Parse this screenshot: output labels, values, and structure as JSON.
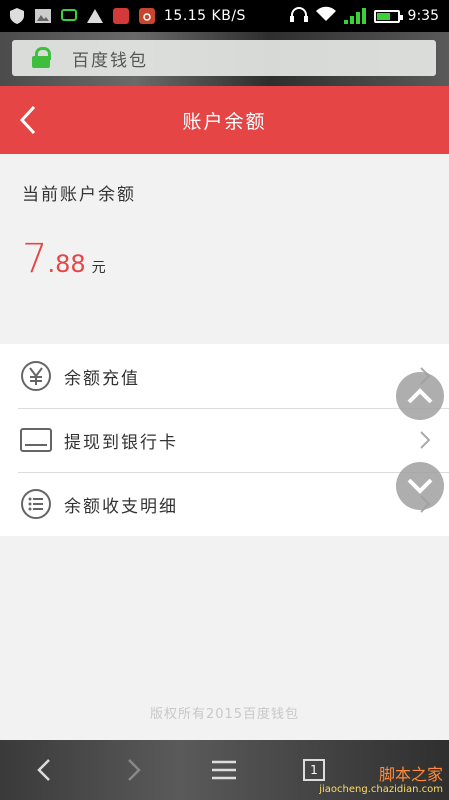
{
  "status_bar": {
    "speed": "15.15 KB/S",
    "time": "9:35"
  },
  "address_bar": {
    "text": "百度钱包"
  },
  "header": {
    "title": "账户余额"
  },
  "balance": {
    "label": "当前账户余额",
    "integer": "7",
    "decimal": ".88",
    "unit": "元"
  },
  "menu": {
    "items": [
      {
        "label": "余额充值",
        "icon": "yuan-icon"
      },
      {
        "label": "提现到银行卡",
        "icon": "card-icon"
      },
      {
        "label": "余额收支明细",
        "icon": "list-icon"
      }
    ]
  },
  "footer": {
    "copyright": "版权所有2015百度钱包"
  },
  "bottom_bar": {
    "tab_count": "1"
  },
  "watermark": {
    "line1": "脚本之家",
    "line2": "jiaocheng.chazidian.com"
  },
  "colors": {
    "accent": "#e64545",
    "lock_green": "#3dbf3d",
    "signal_green": "#3ad13a"
  }
}
